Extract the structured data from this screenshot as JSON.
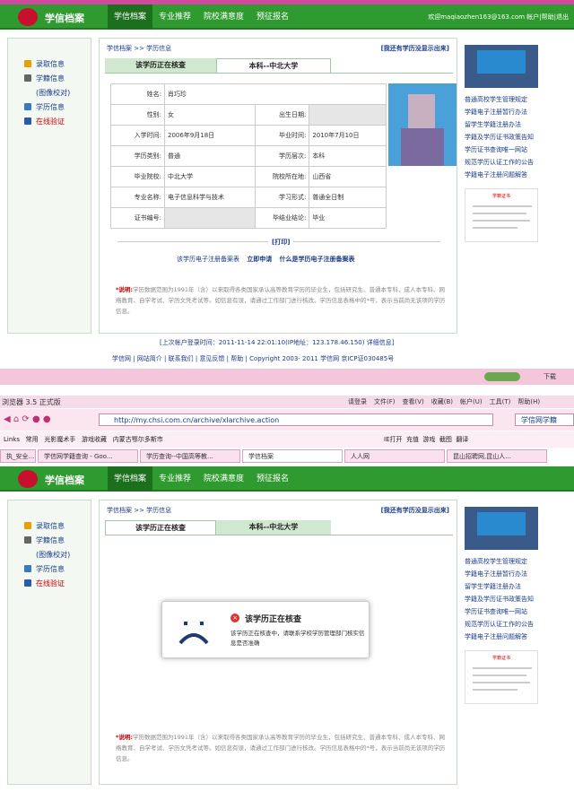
{
  "site": {
    "logo_text": "学信档案",
    "nav": [
      "学信档案",
      "专业推荐",
      "院校满意度",
      "预征报名"
    ],
    "user_info": "欢迎maqiaozhen163@163.com 帐户|帮助|退出"
  },
  "sidebar": {
    "items": [
      "录取信息",
      "学籍信息",
      "(图像校对)",
      "学历信息",
      "在线验证"
    ]
  },
  "breadcrumb": "学信档案 >> 学历信息",
  "missing_link": "[我还有学历没显示出来]",
  "tabs_top": [
    "该学历正在核查",
    "本科--中北大学"
  ],
  "record": {
    "name_label": "姓名:",
    "name": "肖巧珍",
    "gender_label": "性别:",
    "gender": "女",
    "birth_label": "出生日期:",
    "birth": "",
    "enroll_label": "入学时间:",
    "enroll": "2006年9月18日",
    "grad_label": "毕业时间:",
    "grad": "2010年7月10日",
    "type_label": "学历类别:",
    "type": "普通",
    "level_label": "学历层次:",
    "level": "本科",
    "school_label": "毕业院校:",
    "school": "中北大学",
    "loc_label": "院校所在地:",
    "loc": "山西省",
    "major_label": "专业名称:",
    "major": "电子信息科学与技术",
    "form_label": "学习形式:",
    "form": "普通全日制",
    "cert_label": "证书编号:",
    "cert": "",
    "concl_label": "毕结业结论:",
    "concl": "毕业"
  },
  "print_label": "[打印]",
  "reg_links": [
    "该学历电子注册备案表",
    "立即申请",
    "什么是学历电子注册备案表"
  ],
  "note": {
    "prefix": "*说明:",
    "text": "学历数据范围为1991年（含）以来取得各类国家承认高等教育学历的毕业生，包括研究生、普通本专科、成人本专科、网络教育、自学考试、学历文凭考试等。如信息有误，请通过工作部门进行核改。学历信息表格中的*号，表示当前尚无该项的学历信息。"
  },
  "note2": {
    "prefix": "*说明:",
    "text": "学历数据范围为1991年（含）以来取得各类国家承认高等教育学历的毕业生，包括研究生、普通本专科、成人本专科、网络教育、自学考试、学历文凭考试等。如信息有误，请通过工作部门进行核改。学历信息表格中的*号，表示当前尚无该项的学历信息。"
  },
  "right_links": [
    "普通高校学生管理规定",
    "学籍电子注册暂行办法",
    "留学生学籍注册办法",
    "学籍及学历证书政策告知",
    "学历证书查询唯一网站",
    "规范学历认证工作的公告",
    "学籍电子注册问题解答"
  ],
  "cert_title": "学籍证书",
  "last_login": "[上次帐户登录时间：2011-11-14 22:01:10(IP地址：123.178.46.150) 详细信息]",
  "footer": [
    "学信网",
    "网站简介",
    "联系我们",
    "意见反馈",
    "帮助",
    "Copyright 2003- 2011 学信网 京ICP证030485号"
  ],
  "status_icons": [
    "下载"
  ],
  "browser": {
    "title": "浏览器 3.5 正式版",
    "menu": [
      "请登录",
      "文件(F)",
      "查看(V)",
      "收藏(B)",
      "帐户(U)",
      "工具(T)",
      "帮助(H)"
    ],
    "url": "http://my.chsi.com.cn/archive/xlarchive.action",
    "search": "学信网学籍",
    "favorites": [
      "Links",
      "常用",
      "光影魔术手",
      "游戏收藏",
      "内蒙古鄂尔多斯市"
    ],
    "favorites_right": [
      "IE打开",
      "充值",
      "游戏",
      "截图",
      "翻译"
    ],
    "tabs": [
      "执_安全...",
      "学信网学籍查询 - Goo...",
      "学历查询--中国高等教...",
      "学信档案",
      "人人网",
      "昆山招聘网,昆山人..."
    ]
  },
  "dialog": {
    "title": "该学历正在核查",
    "text": "该学历正在核查中，请联系学校学历管理部门核实信息是否准确"
  },
  "colors": {
    "header_green": "#2f9a2f",
    "pink": "#f4c6dc",
    "link": "#1a3a8a"
  }
}
